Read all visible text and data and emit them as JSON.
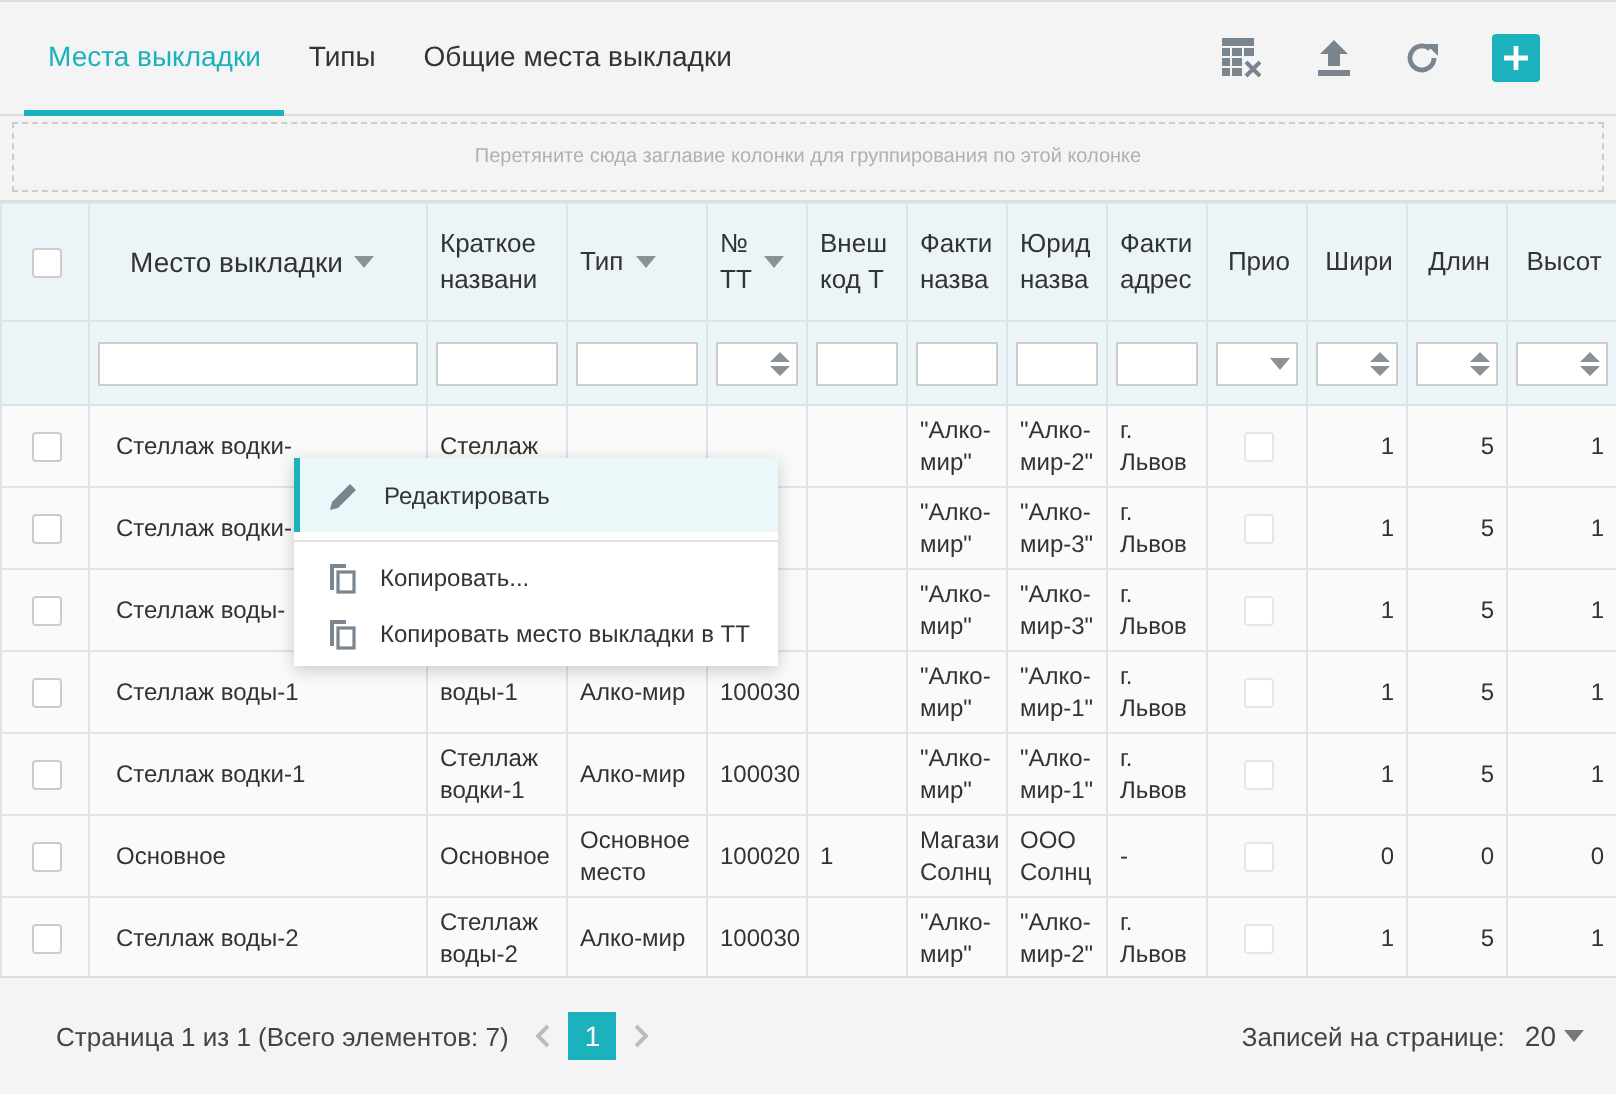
{
  "tabs": [
    {
      "label": "Места выкладки",
      "selected": true
    },
    {
      "label": "Типы",
      "selected": false
    },
    {
      "label": "Общие места выкладки",
      "selected": false
    }
  ],
  "group_panel": {
    "hint": "Перетяните сюда заглавие колонки для группирования по этой колонке"
  },
  "table": {
    "select_all": {
      "checked": false
    },
    "columns": [
      {
        "label": "Место выкладки",
        "menu": true,
        "filter": {
          "kind": "text"
        },
        "numeric": false
      },
      {
        "label": "Краткое\nназвани",
        "menu": false,
        "filter": {
          "kind": "text"
        },
        "numeric": false
      },
      {
        "label": "Тип",
        "menu": true,
        "filter": {
          "kind": "text"
        },
        "numeric": false
      },
      {
        "label": "№\nТТ",
        "menu": true,
        "filter": {
          "kind": "number"
        },
        "numeric": false
      },
      {
        "label": "Внеш\nкод Т",
        "menu": false,
        "filter": {
          "kind": "text"
        },
        "numeric": false
      },
      {
        "label": "Факти\nназва",
        "menu": false,
        "filter": {
          "kind": "text"
        },
        "numeric": false
      },
      {
        "label": "Юрид\nназва",
        "menu": false,
        "filter": {
          "kind": "text"
        },
        "numeric": false
      },
      {
        "label": "Факти\nадрес",
        "menu": false,
        "filter": {
          "kind": "text"
        },
        "numeric": false
      },
      {
        "label": "Прио",
        "menu": false,
        "filter": {
          "kind": "select"
        },
        "kind": "checkbox"
      },
      {
        "label": "Шири",
        "menu": false,
        "filter": {
          "kind": "number"
        },
        "numeric": true
      },
      {
        "label": "Длин",
        "menu": false,
        "filter": {
          "kind": "number"
        },
        "numeric": true
      },
      {
        "label": "Высот",
        "menu": false,
        "filter": {
          "kind": "number"
        },
        "numeric": true
      }
    ],
    "rows": [
      {
        "checked": false,
        "priority": false,
        "cells": [
          "Стеллаж водки-",
          "Стеллаж",
          null,
          null,
          null,
          "\"Алко-\nмир\"",
          "\"Алко-\nмир-2\"",
          "г.\nЛьвов",
          null,
          "1",
          "5",
          "1"
        ]
      },
      {
        "checked": false,
        "priority": false,
        "cells": [
          "Стеллаж водки-",
          null,
          null,
          null,
          null,
          "\"Алко-\nмир\"",
          "\"Алко-\nмир-3\"",
          "г.\nЛьвов",
          null,
          "1",
          "5",
          "1"
        ]
      },
      {
        "checked": false,
        "priority": false,
        "cells": [
          "Стеллаж воды-",
          null,
          null,
          null,
          null,
          "\"Алко-\nмир\"",
          "\"Алко-\nмир-3\"",
          "г.\nЛьвов",
          null,
          "1",
          "5",
          "1"
        ]
      },
      {
        "checked": false,
        "priority": false,
        "cells": [
          "Стеллаж воды-1",
          "воды-1",
          "Алко-мир",
          "100030",
          null,
          "\"Алко-\nмир\"",
          "\"Алко-\nмир-1\"",
          "г.\nЛьвов",
          null,
          "1",
          "5",
          "1"
        ]
      },
      {
        "checked": false,
        "priority": false,
        "cells": [
          "Стеллаж водки-1",
          "Стеллаж\nводки-1",
          "Алко-мир",
          "100030",
          null,
          "\"Алко-\nмир\"",
          "\"Алко-\nмир-1\"",
          "г.\nЛьвов",
          null,
          "1",
          "5",
          "1"
        ]
      },
      {
        "checked": false,
        "priority": false,
        "cells": [
          "Основное",
          "Основное",
          "Основное\nместо",
          "100020",
          "1",
          "Магази\nСолнц",
          "ООО\nСолнц",
          "-",
          null,
          "0",
          "0",
          "0"
        ]
      },
      {
        "checked": false,
        "priority": false,
        "cells": [
          "Стеллаж воды-2",
          "Стеллаж\nводы-2",
          "Алко-мир",
          "100030",
          null,
          "\"Алко-\nмир\"",
          "\"Алко-\nмир-2\"",
          "г.\nЛьвов",
          null,
          "1",
          "5",
          "1"
        ]
      }
    ]
  },
  "context_menu": [
    {
      "label": "Редактировать",
      "kind": "edit",
      "highlighted": true
    },
    {
      "label": "Копировать...",
      "kind": "copy",
      "highlighted": false
    },
    {
      "label": "Копировать место выкладки в ТТ",
      "kind": "copy",
      "highlighted": false
    }
  ],
  "pager": {
    "summary": "Страница 1 из 1 (Всего элементов: 7)",
    "pages": [
      {
        "label": "1",
        "selected": true
      }
    ],
    "page_size_label": "Записей на странице:",
    "page_size": "20"
  }
}
